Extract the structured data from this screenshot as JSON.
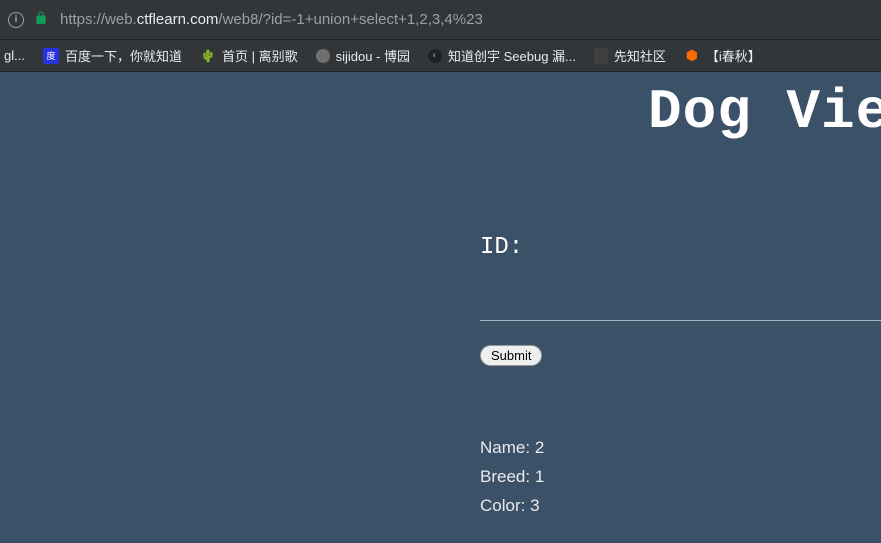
{
  "addressBar": {
    "protocol": "https://",
    "domainPrefix": "web.",
    "domain": "ctflearn.com",
    "path": "/web8/?id=-1+union+select+1,2,3,4%23"
  },
  "bookmarks": [
    {
      "label": "gl...",
      "icon": ""
    },
    {
      "label": "百度一下，你就知道",
      "icon": "baidu"
    },
    {
      "label": "首页 | 离别歌",
      "icon": "cactus"
    },
    {
      "label": "sijidou - 博园",
      "icon": "gray"
    },
    {
      "label": "知道创宇 Seebug 漏...",
      "icon": "dark"
    },
    {
      "label": "先知社区",
      "icon": ""
    },
    {
      "label": "【i春秋】",
      "icon": "orange"
    }
  ],
  "page": {
    "title": "Dog Viewer",
    "form": {
      "idLabel": "ID:",
      "submitLabel": "Submit"
    },
    "results": {
      "nameLabel": "Name:",
      "nameValue": "2",
      "breedLabel": "Breed:",
      "breedValue": "1",
      "colorLabel": "Color:",
      "colorValue": "3"
    }
  }
}
